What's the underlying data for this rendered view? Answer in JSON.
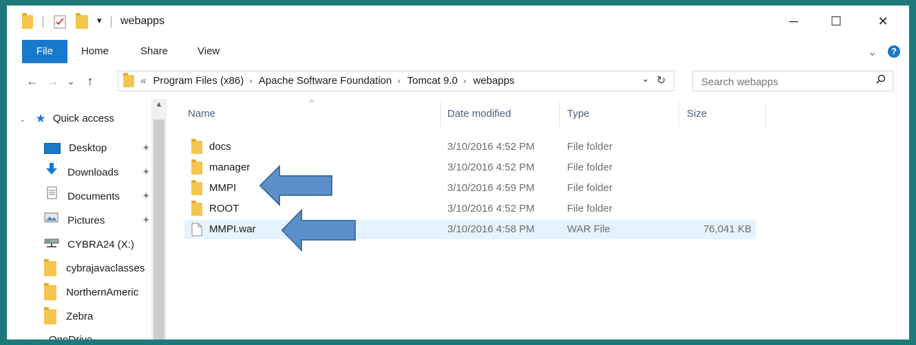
{
  "window": {
    "title": "webapps",
    "minimize": "─",
    "maximize": "☐",
    "close": "✕",
    "qat_dropdown": "▾"
  },
  "ribbon": {
    "tabs": [
      "File",
      "Home",
      "Share",
      "View"
    ],
    "collapse": "⌄",
    "help": "?"
  },
  "nav": {
    "back": "←",
    "forward": "→",
    "recent": "⌄",
    "up": "↑",
    "breadcrumb_prefix": "«",
    "breadcrumbs": [
      "Program Files (x86)",
      "Apache Software Foundation",
      "Tomcat 9.0",
      "webapps"
    ],
    "crumb_sep": "›",
    "address_dropdown": "⌄",
    "refresh": "↻"
  },
  "search": {
    "placeholder": "Search webapps",
    "icon": "search-icon"
  },
  "sidebar": {
    "quick_access": "Quick access",
    "items": [
      {
        "label": "Desktop",
        "icon": "desktop-icon",
        "pinned": true
      },
      {
        "label": "Downloads",
        "icon": "download-icon",
        "pinned": true
      },
      {
        "label": "Documents",
        "icon": "document-icon",
        "pinned": true
      },
      {
        "label": "Pictures",
        "icon": "picture-icon",
        "pinned": true
      },
      {
        "label": "CYBRA24 (X:)",
        "icon": "network-drive-icon",
        "pinned": false
      },
      {
        "label": "cybrajavaclasses",
        "icon": "folder-icon",
        "pinned": false
      },
      {
        "label": "NorthernAmeric",
        "icon": "folder-icon",
        "pinned": false
      },
      {
        "label": "Zebra",
        "icon": "folder-icon",
        "pinned": false
      }
    ],
    "next_group": "OneDrive"
  },
  "columns": {
    "name": "Name",
    "date": "Date modified",
    "type": "Type",
    "size": "Size",
    "sort_indicator": "^"
  },
  "files": [
    {
      "name": "docs",
      "date": "3/10/2016 4:52 PM",
      "type": "File folder",
      "size": "",
      "icon": "folder-icon"
    },
    {
      "name": "manager",
      "date": "3/10/2016 4:52 PM",
      "type": "File folder",
      "size": "",
      "icon": "folder-icon"
    },
    {
      "name": "MMPI",
      "date": "3/10/2016 4:59 PM",
      "type": "File folder",
      "size": "",
      "icon": "folder-icon"
    },
    {
      "name": "ROOT",
      "date": "3/10/2016 4:52 PM",
      "type": "File folder",
      "size": "",
      "icon": "folder-icon"
    },
    {
      "name": "MMPI.war",
      "date": "3/10/2016 4:58 PM",
      "type": "WAR File",
      "size": "76,041 KB",
      "icon": "file-icon",
      "selected": true
    }
  ],
  "colors": {
    "frame": "#1d7a7c",
    "file_tab": "#1979ca",
    "selection": "#e5f3ff",
    "annotation_arrow": "#5b8fc9"
  }
}
